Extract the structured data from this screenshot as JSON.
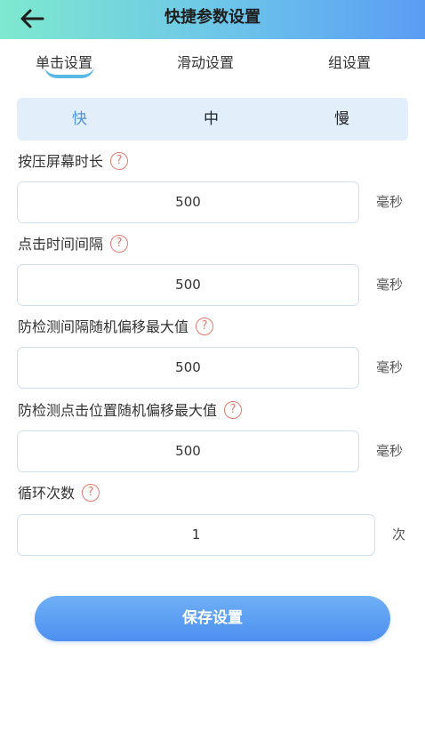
{
  "header": {
    "title": "快捷参数设置",
    "back_icon": "arrow-left-icon"
  },
  "tabs": [
    {
      "label": "单击设置",
      "active": true
    },
    {
      "label": "滑动设置",
      "active": false
    },
    {
      "label": "组设置",
      "active": false
    }
  ],
  "speed": {
    "options": [
      "快",
      "中",
      "慢"
    ],
    "selected": "快",
    "accent": "#4f93d9"
  },
  "settings": [
    {
      "label": "按压屏幕时长",
      "value": "500",
      "unit": "毫秒"
    },
    {
      "label": "点击时间间隔",
      "value": "500",
      "unit": "毫秒"
    },
    {
      "label": "防检测间隔随机偏移最大值",
      "value": "500",
      "unit": "毫秒"
    },
    {
      "label": "防检测点击位置随机偏移最大值",
      "value": "500",
      "unit": "毫秒"
    },
    {
      "label": "循环次数",
      "value": "1",
      "unit": "次"
    }
  ],
  "help_glyph": "?",
  "save_label": "保存设置",
  "colors": {
    "help": "#e47a6e",
    "button": "#4c8ff0",
    "header_start": "#7ee9cf",
    "header_end": "#5a9cf4"
  }
}
